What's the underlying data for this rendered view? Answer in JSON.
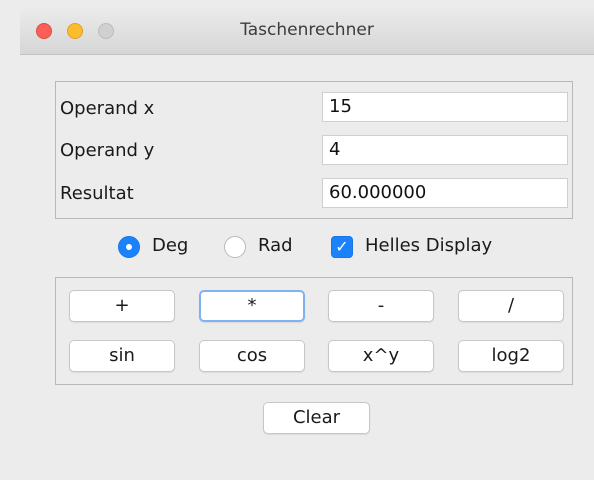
{
  "window": {
    "title": "Taschenrechner"
  },
  "operands": {
    "x_label": "Operand x",
    "x_value": "15",
    "y_label": "Operand y",
    "y_value": "4",
    "result_label": "Resultat",
    "result_value": "60.000000"
  },
  "options": {
    "deg_label": "Deg",
    "deg_selected": true,
    "rad_label": "Rad",
    "rad_selected": false,
    "bright_display_label": "Helles Display",
    "bright_display_checked": true
  },
  "buttons": {
    "add": "+",
    "multiply": "*",
    "subtract": "-",
    "divide": "/",
    "sin": "sin",
    "cos": "cos",
    "power": "x^y",
    "log2": "log2",
    "clear": "Clear"
  },
  "colors": {
    "accent": "#1a82fb",
    "close": "#fc5f57",
    "minimize": "#fdbc2e"
  }
}
